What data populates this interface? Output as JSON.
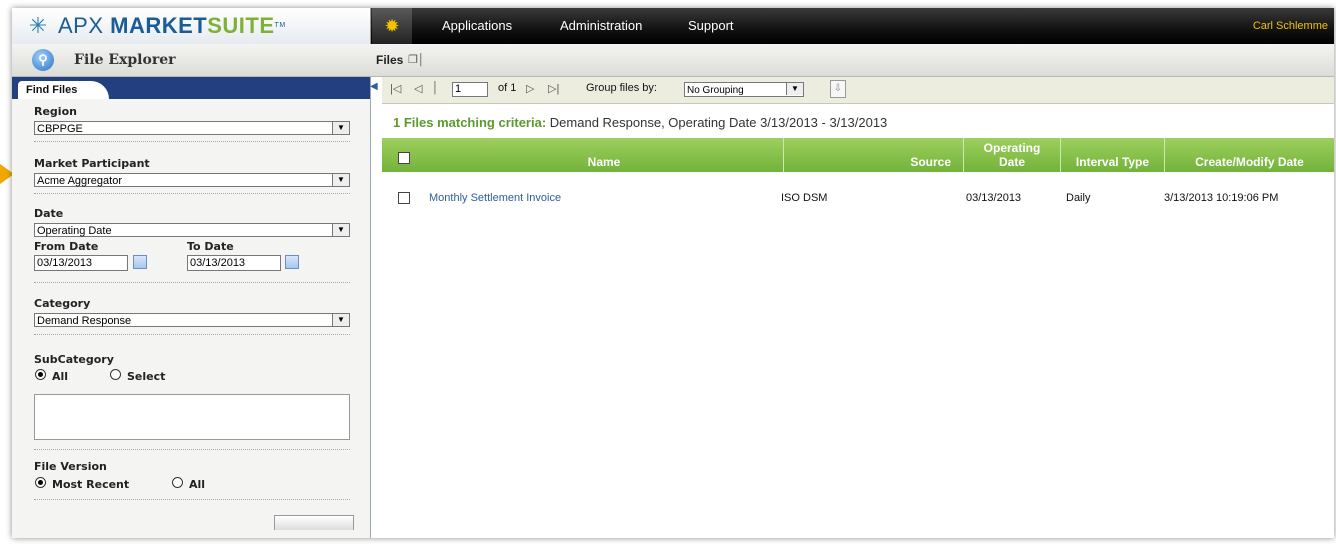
{
  "app": {
    "logo_apx": "APX ",
    "logo_market": "MARKET",
    "logo_suite": "SUITE",
    "logo_tm": "TM",
    "nav": [
      "Applications",
      "Administration",
      "Support"
    ],
    "user": "Carl Schlemme"
  },
  "explorer": {
    "title": "File Explorer",
    "files_tab": "Files"
  },
  "find": {
    "tab": "Find Files",
    "region_label": "Region",
    "region_value": "CBPPGE",
    "participant_label": "Market Participant",
    "participant_value": "Acme Aggregator",
    "date_label": "Date",
    "date_value": "Operating Date",
    "from_label": "From Date",
    "from_value": "03/13/2013",
    "to_label": "To Date",
    "to_value": "03/13/2013",
    "category_label": "Category",
    "category_value": "Demand Response",
    "subcategory_label": "SubCategory",
    "sub_all": "All",
    "sub_select": "Select",
    "version_label": "File Version",
    "ver_recent": "Most Recent",
    "ver_all": "All"
  },
  "pager": {
    "page": "1",
    "of": "of 1",
    "group_label": "Group files by:",
    "group_value": "No Grouping"
  },
  "results": {
    "count_text": "1 Files matching criteria:",
    "criteria_text": " Demand Response, Operating Date 3/13/2013 - 3/13/2013",
    "columns": {
      "name": "Name",
      "source": "Source",
      "op_date_1": "Operating",
      "op_date_2": "Date",
      "interval": "Interval Type",
      "modified": "Create/Modify Date"
    },
    "rows": [
      {
        "name": "Monthly Settlement Invoice",
        "source": "ISO DSM",
        "op_date": "03/13/2013",
        "interval": "Daily",
        "modified": "3/13/2013 10:19:06 PM"
      }
    ]
  }
}
